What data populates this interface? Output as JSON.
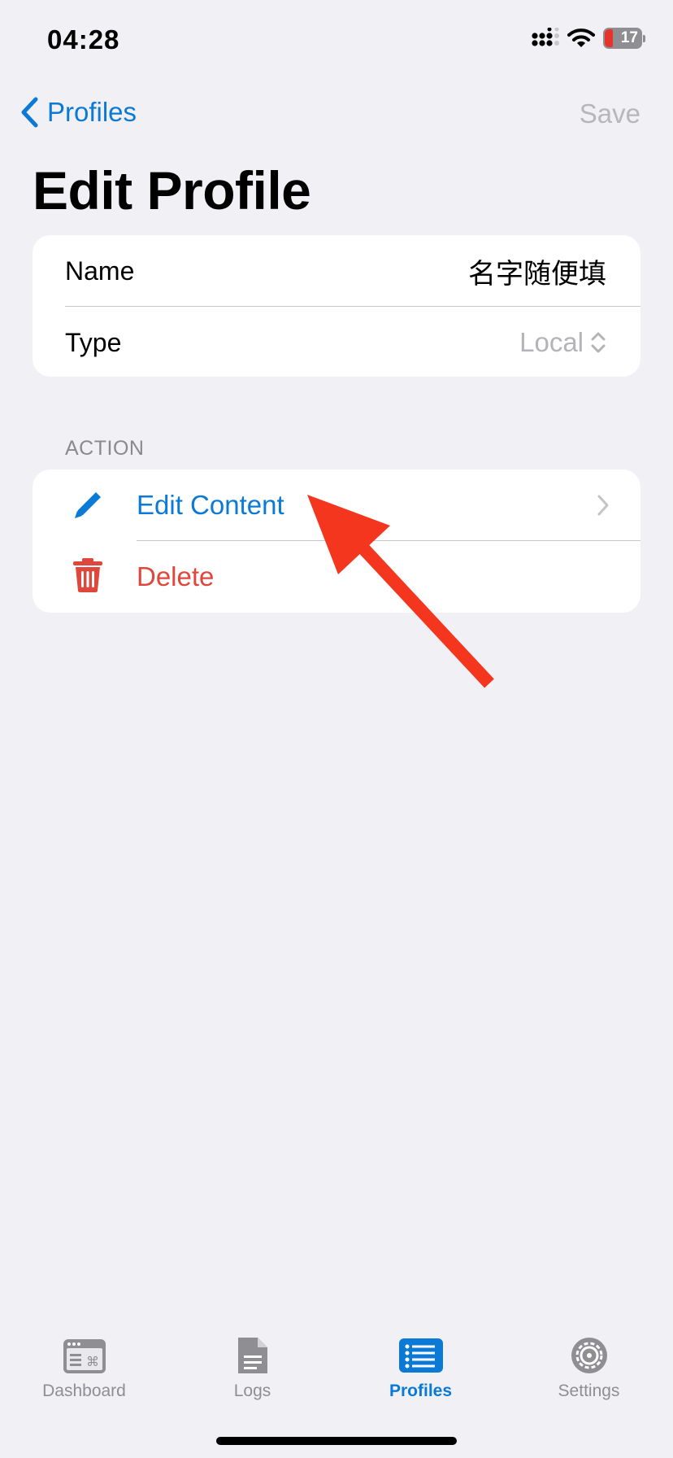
{
  "status_bar": {
    "time": "04:28",
    "battery_level": "17"
  },
  "nav": {
    "back_label": "Profiles",
    "save_label": "Save"
  },
  "page": {
    "title": "Edit Profile"
  },
  "profile_fields": {
    "name_label": "Name",
    "name_value": "名字随便填",
    "type_label": "Type",
    "type_value": "Local"
  },
  "action_section": {
    "header": "ACTION",
    "edit_label": "Edit Content",
    "delete_label": "Delete"
  },
  "tab_bar": {
    "tabs": [
      {
        "label": "Dashboard",
        "icon": "dashboard-icon",
        "active": false
      },
      {
        "label": "Logs",
        "icon": "document-icon",
        "active": false
      },
      {
        "label": "Profiles",
        "icon": "list-icon",
        "active": true
      },
      {
        "label": "Settings",
        "icon": "gear-icon",
        "active": false
      }
    ]
  },
  "colors": {
    "accent": "#0b7ad6",
    "destructive": "#e0473c",
    "annotation_arrow": "#f5361f",
    "background": "#f0f0f5"
  }
}
